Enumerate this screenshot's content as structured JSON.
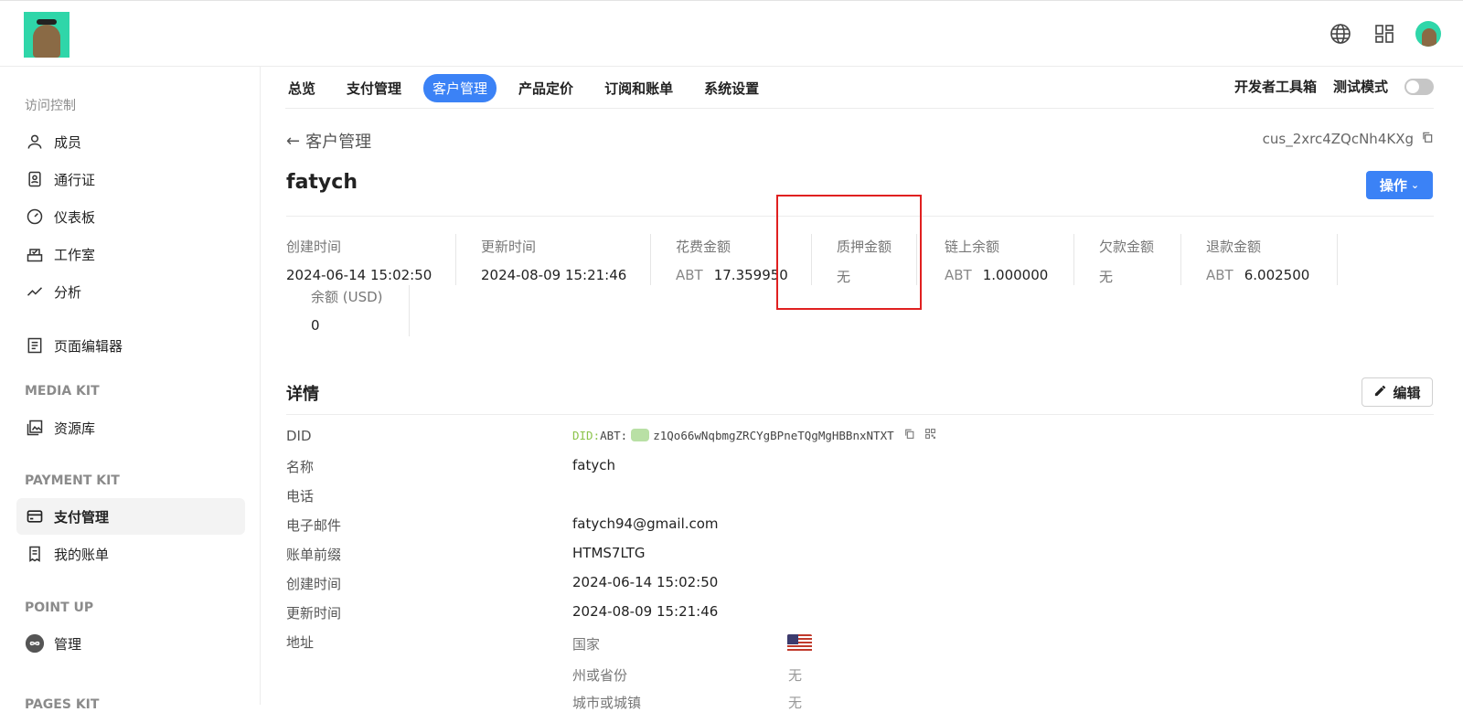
{
  "header": {
    "icons": [
      "globe-icon",
      "apps-grid-icon",
      "user-avatar"
    ]
  },
  "sidebar": {
    "section_access": "访问控制",
    "items_access": [
      {
        "label": "成员",
        "icon": "user-icon"
      },
      {
        "label": "通行证",
        "icon": "badge-icon"
      },
      {
        "label": "仪表板",
        "icon": "gauge-icon"
      },
      {
        "label": "工作室",
        "icon": "studio-icon"
      },
      {
        "label": "分析",
        "icon": "analytics-icon"
      }
    ],
    "page_editor": "页面编辑器",
    "section_media": "MEDIA KIT",
    "media_item": "资源库",
    "section_payment": "PAYMENT KIT",
    "payment_items": [
      "支付管理",
      "我的账单"
    ],
    "section_point": "POINT UP",
    "point_item": "管理",
    "section_pages": "PAGES KIT"
  },
  "tabs": [
    "总览",
    "支付管理",
    "客户管理",
    "产品定价",
    "订阅和账单",
    "系统设置"
  ],
  "active_tab": "客户管理",
  "tabs_right": {
    "devtools": "开发者工具箱",
    "test_mode": "测试模式",
    "test_mode_on": false
  },
  "page": {
    "back_label": "客户管理",
    "customer_id": "cus_2xrc4ZQcNh4KXg",
    "customer_name": "fatych",
    "actions_label": "操作"
  },
  "stats": {
    "created": {
      "label": "创建时间",
      "value": "2024-06-14 15:02:50"
    },
    "updated": {
      "label": "更新时间",
      "value": "2024-08-09 15:21:46"
    },
    "spent": {
      "label": "花费金额",
      "currency": "ABT",
      "value": "17.359950"
    },
    "staked": {
      "label": "质押金额",
      "value": "无"
    },
    "onchain": {
      "label": "链上余额",
      "currency": "ABT",
      "value": "1.000000"
    },
    "owed": {
      "label": "欠款金额",
      "value": "无"
    },
    "refund": {
      "label": "退款金额",
      "currency": "ABT",
      "value": "6.002500"
    },
    "balance": {
      "label": "余额 (USD)",
      "value": "0"
    }
  },
  "details": {
    "title": "详情",
    "edit_label": "编辑",
    "did_label": "DID",
    "did_prefix": "DID:",
    "did_chain": "ABT:",
    "did_value": "z1Qo66wNqbmgZRCYgBPneTQgMgHBBnxNTXT",
    "rows": [
      {
        "label": "名称",
        "value": "fatych"
      },
      {
        "label": "电话",
        "value": ""
      },
      {
        "label": "电子邮件",
        "value": "fatych94@gmail.com"
      },
      {
        "label": "账单前缀",
        "value": "HTMS7LTG"
      },
      {
        "label": "创建时间",
        "value": "2024-06-14 15:02:50"
      },
      {
        "label": "更新时间",
        "value": "2024-08-09 15:21:46"
      }
    ],
    "address_label": "地址",
    "address": {
      "country_label": "国家",
      "country_flag": "us-flag",
      "state_label": "州或省份",
      "state_value": "无",
      "city_label": "城市或城镇",
      "city_value": "无"
    }
  }
}
